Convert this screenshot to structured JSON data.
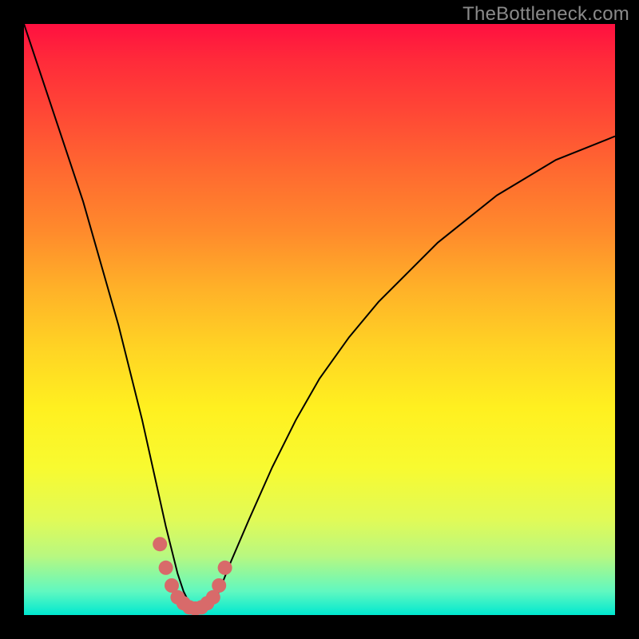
{
  "watermark": "TheBottleneck.com",
  "colors": {
    "frame": "#000000",
    "watermark_text": "#8a8a8a",
    "curve_stroke": "#000000",
    "marker_stroke": "#d86a6a",
    "gradient_stops": [
      {
        "pos": 0.0,
        "hex": "#ff1040"
      },
      {
        "pos": 0.5,
        "hex": "#ffd424"
      },
      {
        "pos": 1.0,
        "hex": "#00e8d0"
      }
    ]
  },
  "chart_data": {
    "type": "line",
    "title": "",
    "xlabel": "",
    "ylabel": "",
    "xlim": [
      0,
      100
    ],
    "ylim": [
      0,
      100
    ],
    "series": [
      {
        "name": "bottleneck-curve",
        "x": [
          0,
          2,
          4,
          6,
          8,
          10,
          12,
          14,
          16,
          18,
          20,
          22,
          24,
          26,
          27,
          28,
          29,
          30,
          31,
          32,
          33,
          35,
          38,
          42,
          46,
          50,
          55,
          60,
          65,
          70,
          75,
          80,
          85,
          90,
          95,
          100
        ],
        "y": [
          100,
          94,
          88,
          82,
          76,
          70,
          63,
          56,
          49,
          41,
          33,
          24,
          15,
          7,
          4,
          2,
          1.2,
          1,
          1.2,
          2,
          4,
          9,
          16,
          25,
          33,
          40,
          47,
          53,
          58,
          63,
          67,
          71,
          74,
          77,
          79,
          81
        ]
      }
    ],
    "markers": {
      "name": "highlight-near-min",
      "x": [
        23,
        24,
        25,
        26,
        27,
        28,
        29,
        30,
        31,
        32,
        33,
        34
      ],
      "y": [
        12,
        8,
        5,
        3,
        2,
        1.3,
        1.1,
        1.3,
        2,
        3,
        5,
        8
      ]
    },
    "annotations": []
  }
}
